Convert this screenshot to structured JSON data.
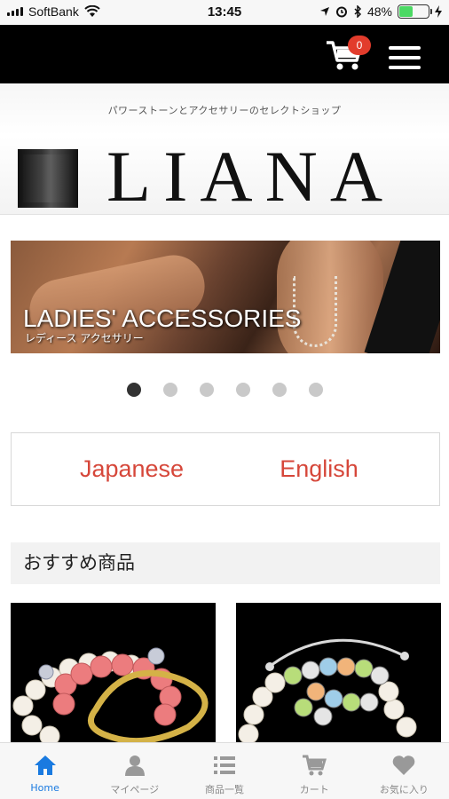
{
  "status_bar": {
    "carrier": "SoftBank",
    "time": "13:45",
    "battery": "48%",
    "battery_level": 0.48
  },
  "header": {
    "cart_count": "0",
    "cart_icon": "cart-icon",
    "menu_icon": "hamburger-menu-icon"
  },
  "brand": {
    "tagline": "パワーストーンとアクセサリーのセレクトショップ",
    "logo_text": "LIANA"
  },
  "hero": {
    "title": "LADIES' ACCESSORIES",
    "subtitle": "レディース アクセサリー",
    "slide_count": 6,
    "active_slide": 1
  },
  "languages": {
    "japanese": "Japanese",
    "english": "English",
    "color": "#d6473a"
  },
  "section": {
    "title": "おすすめ商品"
  },
  "tabs": [
    {
      "label": "Home",
      "icon": "home-icon",
      "active": true
    },
    {
      "label": "マイページ",
      "icon": "user-icon",
      "active": false
    },
    {
      "label": "商品一覧",
      "icon": "list-icon",
      "active": false
    },
    {
      "label": "カート",
      "icon": "cart-icon",
      "active": false
    },
    {
      "label": "お気に入り",
      "icon": "heart-icon",
      "active": false
    }
  ],
  "colors": {
    "accent": "#1a7ae0",
    "header_bg": "#000000",
    "badge": "#e23c2c"
  }
}
